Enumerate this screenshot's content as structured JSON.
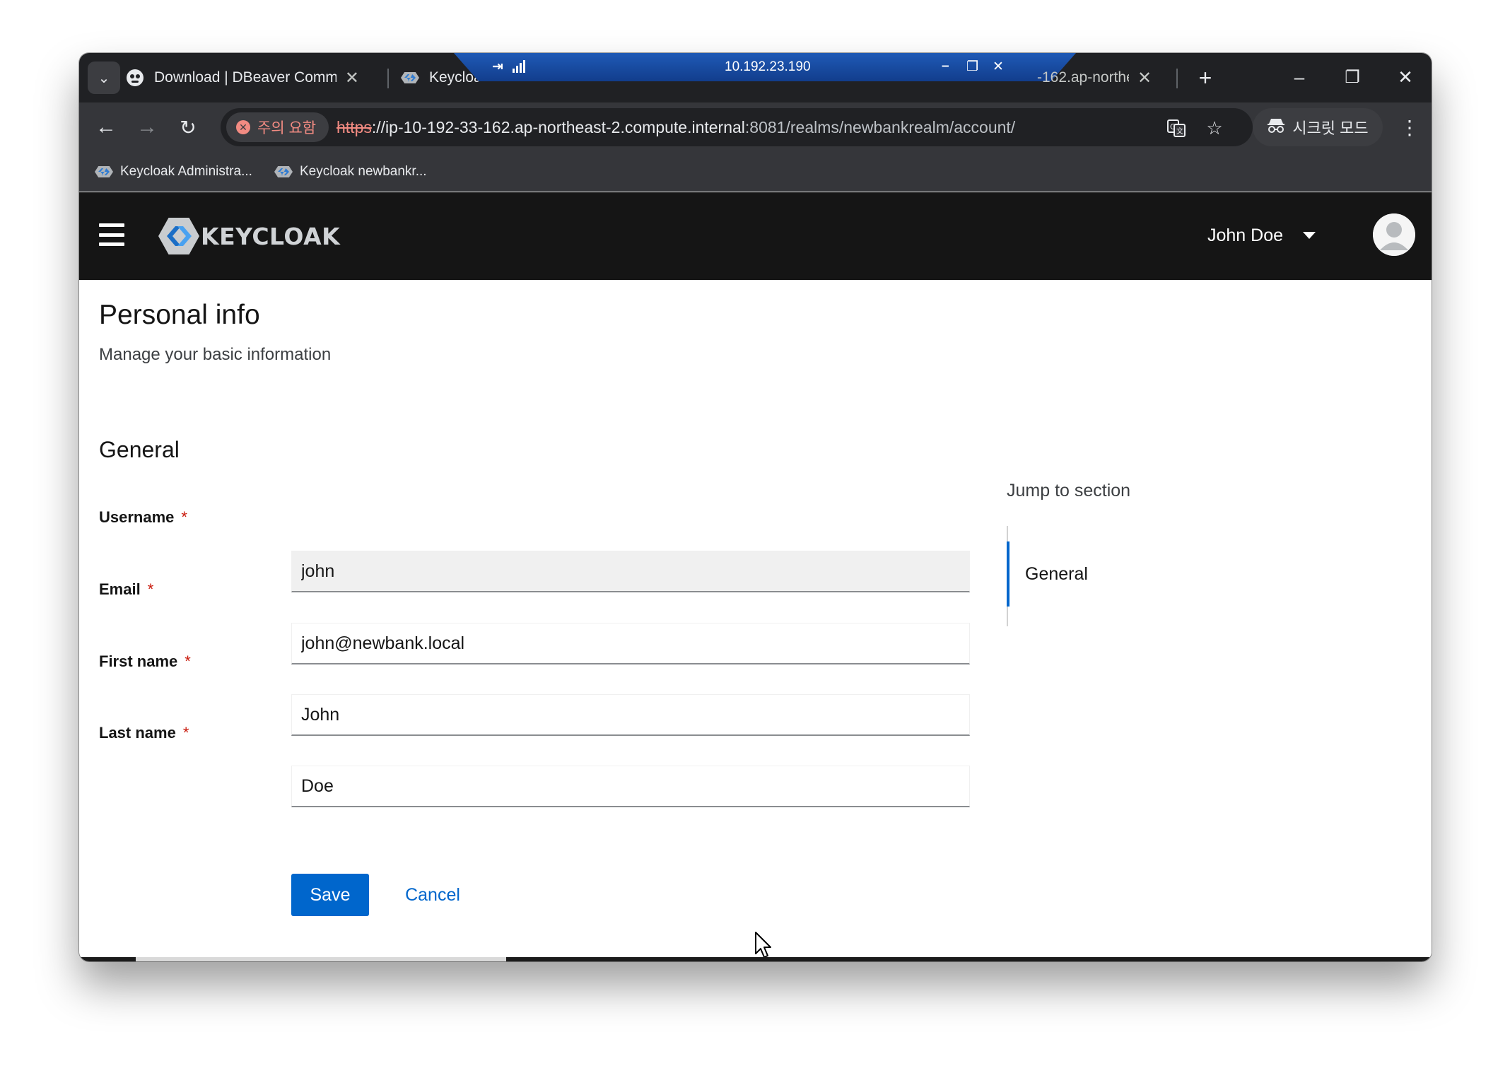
{
  "browser": {
    "tabs": [
      {
        "title": "Download | DBeaver Commur",
        "icon": "dbeaver-icon"
      },
      {
        "title": "Keycloak",
        "icon": "keycloak-icon"
      },
      {
        "title": "-162.ap-northea",
        "icon": "keycloak-icon"
      }
    ],
    "tab_close_glyph": "✕",
    "new_tab_glyph": "+",
    "remote_session": {
      "address": "10.192.23.190"
    },
    "security_chip": "주의 요함",
    "url": {
      "scheme": "https",
      "host": "://ip-10-192-33-162.ap-northeast-2.compute.internal",
      "rest": ":8081/realms/newbankrealm/account/"
    },
    "incognito_label": "시크릿 모드",
    "bookmarks": [
      {
        "label": "Keycloak Administra..."
      },
      {
        "label": "Keycloak newbankr..."
      }
    ]
  },
  "header": {
    "logo_text": "KEYCLOAK",
    "user_name": "John Doe"
  },
  "page": {
    "title": "Personal info",
    "subtitle": "Manage your basic information",
    "section_title": "General",
    "required_marker": "*",
    "fields": [
      {
        "label": "Username",
        "value": "john"
      },
      {
        "label": "Email",
        "value": "john@newbank.local"
      },
      {
        "label": "First name",
        "value": "John"
      },
      {
        "label": "Last name",
        "value": "Doe"
      }
    ],
    "save_label": "Save",
    "cancel_label": "Cancel"
  },
  "jump": {
    "title": "Jump to section",
    "items": [
      {
        "label": "General"
      }
    ]
  },
  "colors": {
    "accent": "#0066cc",
    "header_bg": "#151515",
    "required": "#c9190b"
  }
}
